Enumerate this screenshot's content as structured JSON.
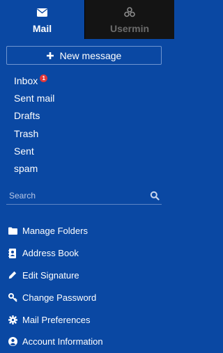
{
  "tabs": {
    "mail": {
      "label": "Mail",
      "icon": "envelope-icon"
    },
    "usermin": {
      "label": "Usermin",
      "icon": "webmin-logo-icon"
    }
  },
  "new_message": {
    "label": "New message",
    "icon": "plus-icon"
  },
  "folders": [
    {
      "label": "Inbox",
      "badge": "1"
    },
    {
      "label": "Sent mail"
    },
    {
      "label": "Drafts"
    },
    {
      "label": "Trash"
    },
    {
      "label": "Sent"
    },
    {
      "label": "spam"
    }
  ],
  "search": {
    "placeholder": "Search",
    "icon": "search-icon"
  },
  "menu": [
    {
      "label": "Manage Folders",
      "icon": "folder-icon"
    },
    {
      "label": "Address Book",
      "icon": "address-book-icon"
    },
    {
      "label": "Edit Signature",
      "icon": "pencil-icon"
    },
    {
      "label": "Change Password",
      "icon": "key-icon"
    },
    {
      "label": "Mail Preferences",
      "icon": "gear-icon"
    },
    {
      "label": "Account Information",
      "icon": "user-circle-icon"
    }
  ],
  "colors": {
    "background": "#0a48a3",
    "active_tab_dark": "#141414",
    "badge": "#e1373a"
  }
}
